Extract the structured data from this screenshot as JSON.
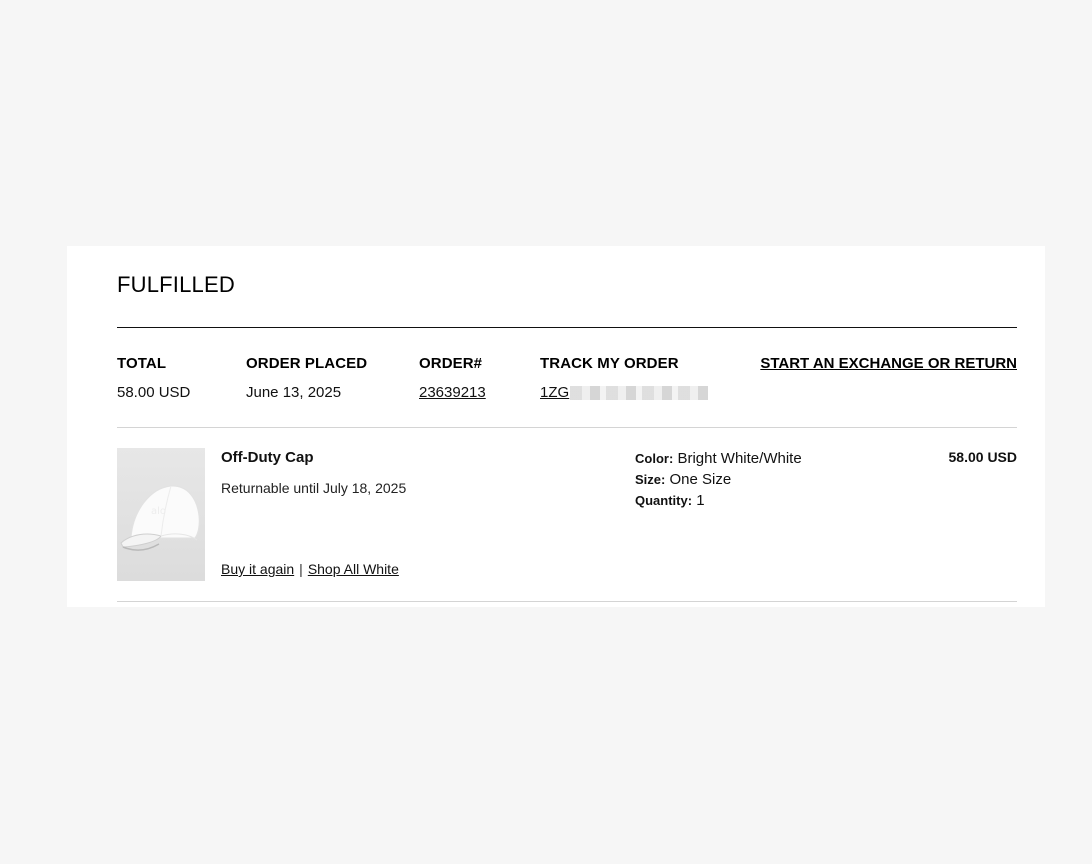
{
  "order": {
    "status": "FULFILLED",
    "summary": {
      "total_label": "TOTAL",
      "total_value": "58.00 USD",
      "placed_label": "ORDER PLACED",
      "placed_value": "June 13, 2025",
      "order_label": "ORDER#",
      "order_number": "23639213",
      "track_label": "TRACK MY ORDER",
      "tracking_visible": "1ZG"
    },
    "exchange_link": "START AN EXCHANGE OR RETURN"
  },
  "item": {
    "name": "Off-Duty Cap",
    "returnable": "Returnable until July 18, 2025",
    "buy_again": "Buy it again",
    "separator": "|",
    "shop_all": "Shop All White",
    "color_label": "Color:",
    "color_value": "Bright White/White",
    "size_label": "Size:",
    "size_value": "One Size",
    "quantity_label": "Quantity:",
    "quantity_value": "1",
    "price": "58.00 USD",
    "image_icon": "cap-product-image"
  }
}
